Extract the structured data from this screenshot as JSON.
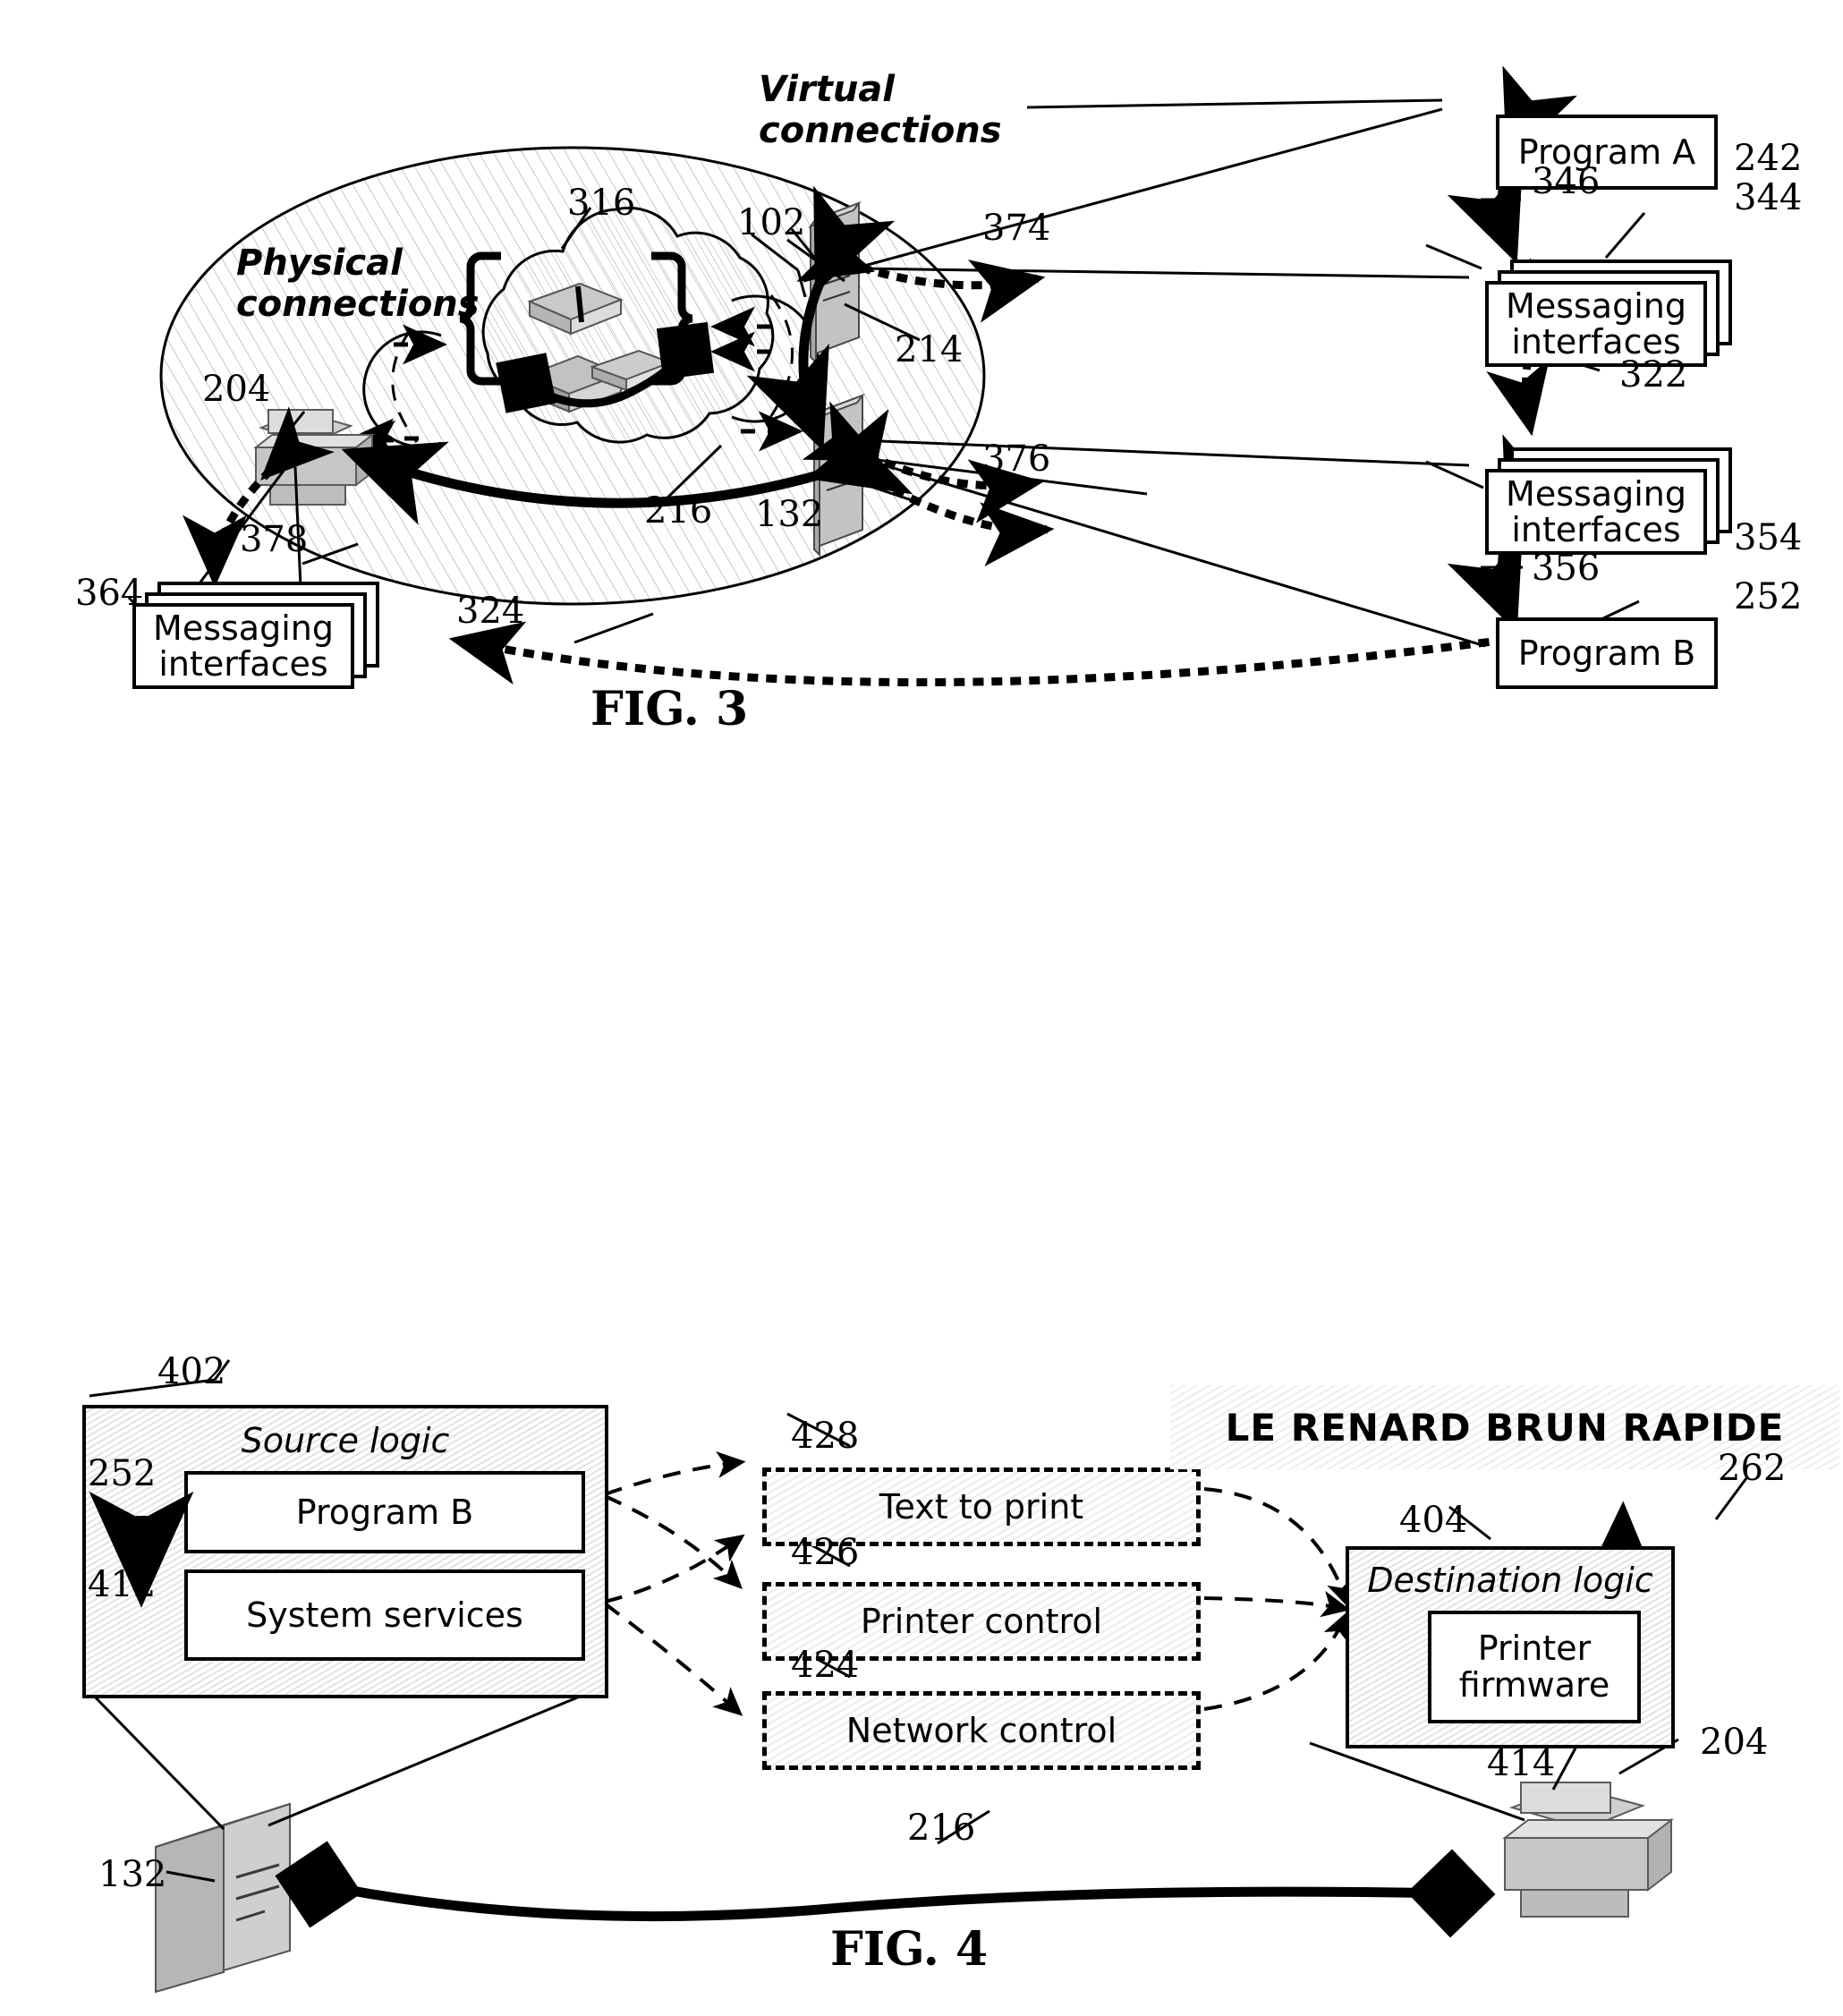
{
  "figures": [
    {
      "id": "fig3",
      "caption": "FIG. 3",
      "annotations": {
        "physical_connections": "Physical\nconnections",
        "physical_connections_line1": "Physical",
        "physical_connections_line2": "connections",
        "virtual_connections_line1": "Virtual",
        "virtual_connections_line2": "connections"
      },
      "boxes": [
        {
          "name": "program-a",
          "label": "Program A",
          "ref": "242"
        },
        {
          "name": "messaging-interfaces-top",
          "label_line1": "Messaging",
          "label_line2": "interfaces",
          "ref": "344"
        },
        {
          "name": "messaging-interfaces-right",
          "label_line1": "Messaging",
          "label_line2": "interfaces",
          "ref": "354"
        },
        {
          "name": "program-b",
          "label": "Program B",
          "ref": "252"
        },
        {
          "name": "messaging-interfaces-left",
          "label_line1": "Messaging",
          "label_line2": "interfaces",
          "ref": "364"
        }
      ],
      "refs": [
        {
          "id": "316",
          "target": "network-cloud"
        },
        {
          "id": "102",
          "target": "server-top"
        },
        {
          "id": "132",
          "target": "server-bottom"
        },
        {
          "id": "204",
          "target": "printer"
        },
        {
          "id": "214",
          "target": "virtual-link-top"
        },
        {
          "id": "216",
          "target": "physical-link"
        },
        {
          "id": "322",
          "target": "messaging-link-vertical"
        },
        {
          "id": "324",
          "target": "messaging-link-long"
        },
        {
          "id": "346",
          "target": "program-a-link"
        },
        {
          "id": "356",
          "target": "program-b-link"
        },
        {
          "id": "374",
          "target": "server-top-interface-link"
        },
        {
          "id": "376",
          "target": "server-bottom-interface-link"
        },
        {
          "id": "378",
          "target": "printer-interface-link"
        }
      ]
    },
    {
      "id": "fig4",
      "caption": "FIG. 4",
      "printed_output": "LE RENARD BRUN RAPIDE",
      "boxes": [
        {
          "name": "source-logic",
          "label": "Source logic",
          "ref": "402"
        },
        {
          "name": "program-b",
          "label": "Program B",
          "ref": "252"
        },
        {
          "name": "system-services",
          "label": "System services",
          "ref": "412"
        },
        {
          "name": "text-to-print",
          "label": "Text to print",
          "ref": "428"
        },
        {
          "name": "printer-control",
          "label": "Printer control",
          "ref": "426"
        },
        {
          "name": "network-control",
          "label": "Network control",
          "ref": "424"
        },
        {
          "name": "destination-logic",
          "label": "Destination logic",
          "ref": "404"
        },
        {
          "name": "printer-firmware",
          "label_line1": "Printer",
          "label_line2": "firmware",
          "ref": "414"
        }
      ],
      "refs": [
        {
          "id": "132",
          "target": "source-server"
        },
        {
          "id": "204",
          "target": "destination-printer"
        },
        {
          "id": "216",
          "target": "physical-link"
        },
        {
          "id": "262",
          "target": "printed-page-link"
        }
      ]
    }
  ],
  "colors": {
    "ink": "#000000",
    "paper": "#ffffff",
    "shade": "#e9e9e9",
    "device_fill": "#d8d8d8"
  }
}
